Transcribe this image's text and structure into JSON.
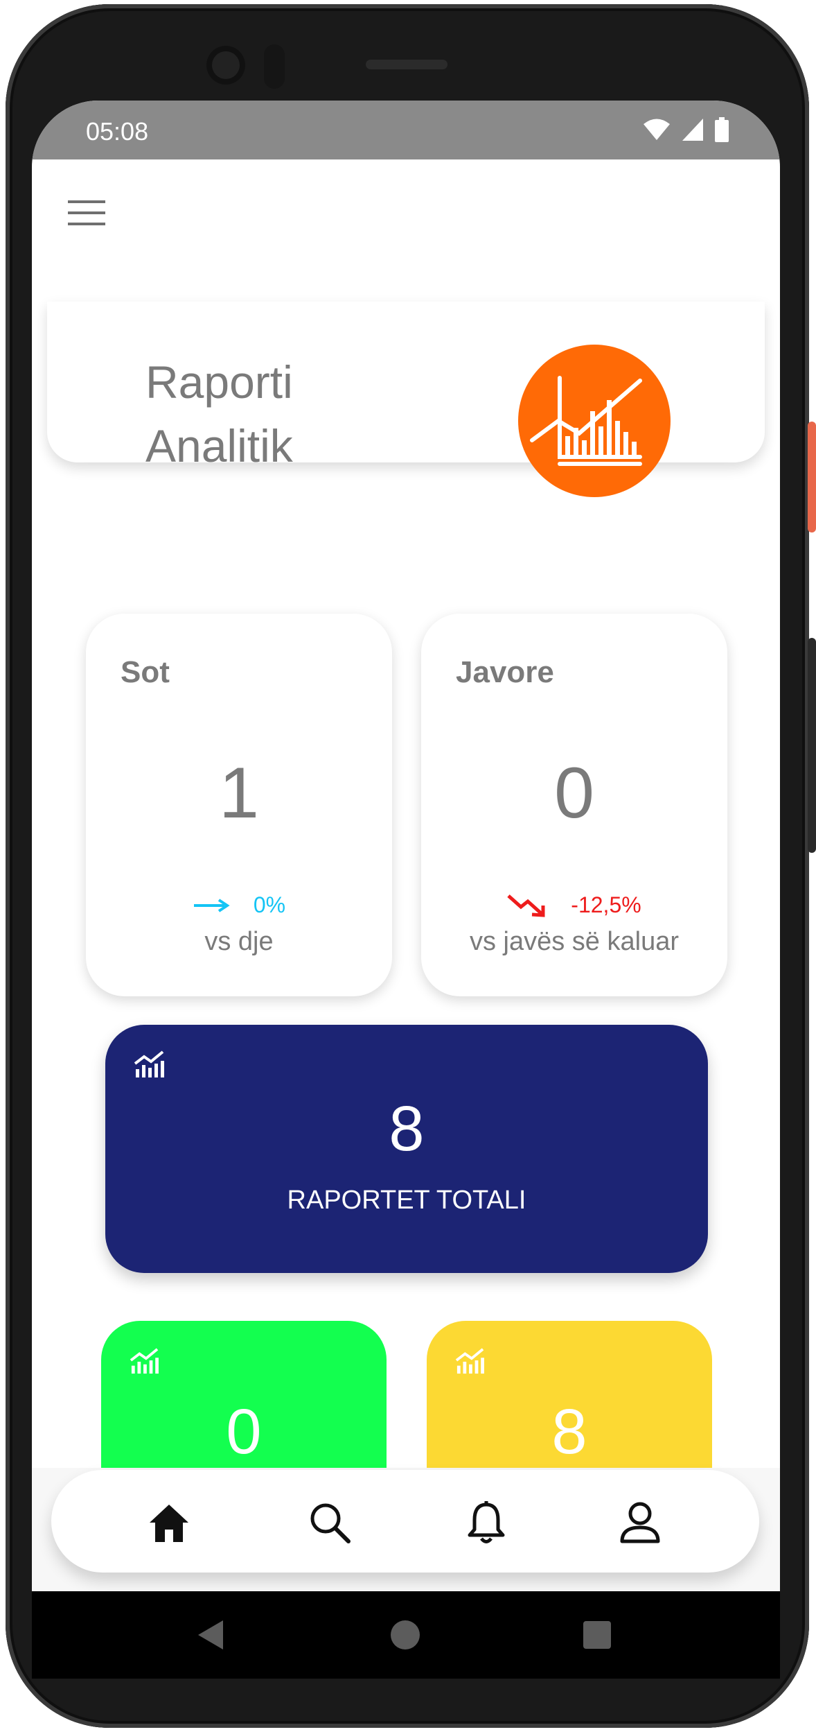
{
  "status_bar": {
    "time": "05:08",
    "icons": [
      "wifi-icon",
      "signal-icon",
      "battery-icon"
    ]
  },
  "header": {
    "menu_icon": "hamburger-menu-icon"
  },
  "hero": {
    "title": "Raporti\nAnalitik",
    "icon": "analytics-chart-icon",
    "icon_color": "#ff6a06"
  },
  "stats": [
    {
      "title": "Sot",
      "value": "1",
      "trend_icon": "arrow-right-icon",
      "trend_value": "0%",
      "trend_color": "#14c4f5",
      "comparison": "vs dje"
    },
    {
      "title": "Javore",
      "value": "0",
      "trend_icon": "trending-down-icon",
      "trend_value": "-12,5%",
      "trend_color": "#ee1c1c",
      "comparison": "vs javës së kaluar"
    }
  ],
  "total_card": {
    "value": "8",
    "label": "RAPORTET TOTALI",
    "icon": "analytics-icon",
    "color": "#1c2474"
  },
  "mini_cards": [
    {
      "value": "0",
      "icon": "analytics-icon",
      "color": "#13ff4f"
    },
    {
      "value": "8",
      "icon": "analytics-icon",
      "color": "#fcd933"
    }
  ],
  "bottom_nav": {
    "items": [
      "home-icon",
      "search-icon",
      "bell-icon",
      "user-icon"
    ]
  },
  "system_nav": {
    "items": [
      "back-icon",
      "home-circle-icon",
      "recent-apps-icon"
    ]
  }
}
